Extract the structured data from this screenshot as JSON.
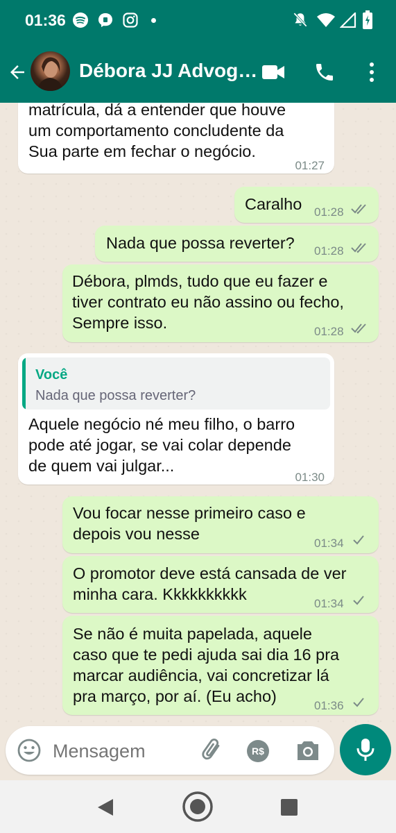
{
  "status_bar": {
    "time": "01:36",
    "notification_icons": [
      "spotify-icon",
      "messenger-icon",
      "instagram-icon",
      "dot-icon"
    ],
    "system_icons": [
      "mute-icon",
      "wifi-icon",
      "signal-icon",
      "battery-icon"
    ]
  },
  "header": {
    "contact_name": "Débora JJ Advog…",
    "icons": [
      "back-arrow-icon",
      "avatar",
      "video-call-icon",
      "phone-icon",
      "more-options-icon"
    ]
  },
  "messages": [
    {
      "direction": "in",
      "lines": [
        "matrícula, dá a entender que houve",
        "um comportamento concludente da",
        "Sua parte em fechar o negócio."
      ],
      "time": "01:27"
    },
    {
      "direction": "out",
      "lines": [
        "Caralho"
      ],
      "time": "01:28",
      "status": "read"
    },
    {
      "direction": "out",
      "lines": [
        "Nada que possa reverter?"
      ],
      "time": "01:28",
      "status": "read"
    },
    {
      "direction": "out",
      "lines": [
        "Débora, plmds, tudo que eu fazer e",
        "tiver contrato eu não assino ou fecho,",
        "Sempre isso."
      ],
      "time": "01:28",
      "status": "read"
    },
    {
      "direction": "in",
      "quote": {
        "author": "Você",
        "text": "Nada que possa reverter?"
      },
      "lines": [
        "Aquele negócio né meu filho, o barro",
        "pode até jogar, se vai colar depende",
        "de quem vai julgar..."
      ],
      "time": "01:30"
    },
    {
      "direction": "out",
      "lines": [
        "Vou focar nesse primeiro caso e",
        "depois vou nesse"
      ],
      "time": "01:34",
      "status": "sent"
    },
    {
      "direction": "out",
      "lines": [
        "O promotor deve está cansada de ver",
        "minha cara.  Kkkkkkkkkk"
      ],
      "time": "01:34",
      "status": "sent"
    },
    {
      "direction": "out",
      "lines": [
        "Se não é muita papelada, aquele",
        "caso que te pedi ajuda sai dia 16 pra",
        "marcar audiência, vai concretizar lá",
        "pra março, por aí. (Eu acho)"
      ],
      "time": "01:36",
      "status": "sent"
    }
  ],
  "composer": {
    "placeholder": "Mensagem",
    "icons": [
      "emoji-icon",
      "attach-icon",
      "payment-icon",
      "camera-icon",
      "mic-icon"
    ],
    "payment_label": "R$"
  },
  "nav_bar": {
    "icons": [
      "back-nav-icon",
      "home-nav-icon",
      "recents-nav-icon"
    ]
  },
  "colors": {
    "header": "#00796b",
    "outgoing": "#dcf8c6",
    "incoming": "#ffffff",
    "accent": "#00897b",
    "quote_author": "#06a884",
    "read_ticks": "#7b8a87"
  }
}
